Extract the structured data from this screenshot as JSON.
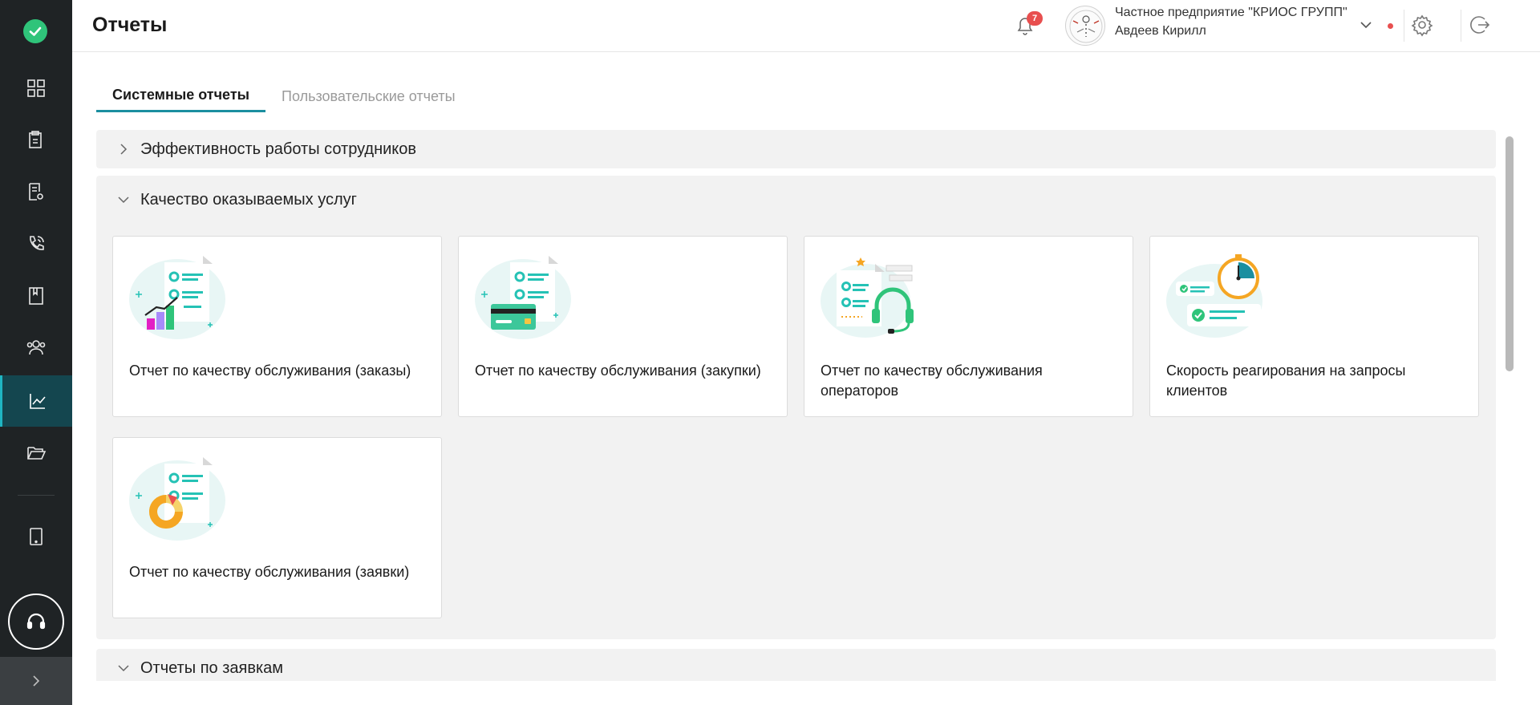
{
  "header": {
    "title": "Отчеты",
    "notifications_count": "7",
    "organization": "Частное предприятие \"КРИОС ГРУПП\"",
    "user_name": "Авдеев Кирилл"
  },
  "sidebar": {
    "items": [
      {
        "icon": "dashboard-icon"
      },
      {
        "icon": "clipboard-icon"
      },
      {
        "icon": "document-settings-icon"
      },
      {
        "icon": "phone-icon"
      },
      {
        "icon": "book-icon"
      },
      {
        "icon": "users-icon"
      },
      {
        "icon": "chart-icon",
        "active": true
      },
      {
        "icon": "folder-open-icon"
      },
      {
        "icon": "tablet-icon"
      }
    ]
  },
  "tabs": [
    {
      "label": "Системные отчеты",
      "active": true
    },
    {
      "label": "Пользовательские отчеты",
      "active": false
    }
  ],
  "sections": [
    {
      "title": "Эффективность работы сотрудников",
      "expanded": false
    },
    {
      "title": "Качество оказываемых услуг",
      "expanded": true,
      "cards": [
        {
          "title": "Отчет по качеству обслуживания (заказы)",
          "icon": "orders-chart-illustration"
        },
        {
          "title": "Отчет по качеству обслуживания (закупки)",
          "icon": "purchase-card-illustration"
        },
        {
          "title": "Отчет по качеству обслуживания операторов",
          "icon": "operator-headset-illustration"
        },
        {
          "title": "Скорость реагирования на запросы клиентов",
          "icon": "stopwatch-illustration"
        },
        {
          "title": "Отчет по качеству обслуживания (заявки)",
          "icon": "requests-donut-illustration"
        }
      ]
    },
    {
      "title": "Отчеты по заявкам",
      "expanded": true
    }
  ],
  "colors": {
    "sidebar_bg": "#1f2325",
    "sidebar_active": "#14464f",
    "accent": "#1b8fa0",
    "section_bg": "#f2f2f2",
    "badge": "#e84f4f"
  }
}
